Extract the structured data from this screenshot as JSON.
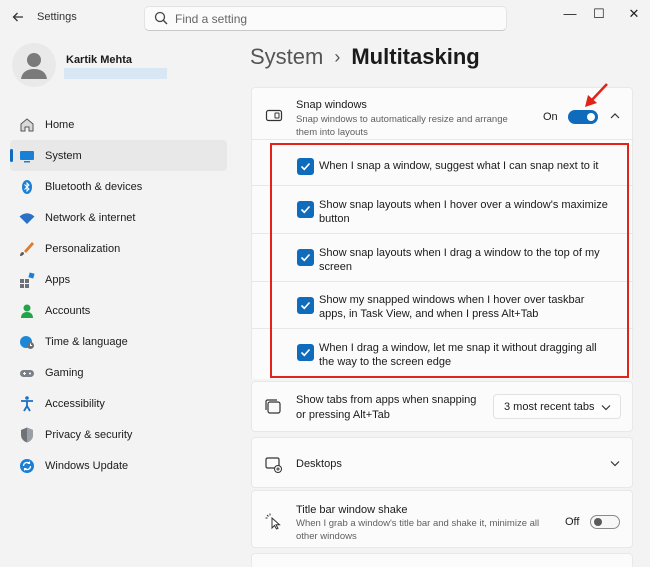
{
  "titlebar": {
    "app_title": "Settings",
    "search_placeholder": "Find a setting",
    "minimize": "—",
    "maximize": "☐",
    "close": "✕"
  },
  "user": {
    "name": "Kartik Mehta"
  },
  "sidebar": {
    "items": [
      {
        "label": "Home",
        "icon": "home-icon",
        "color": "#2d7fd3"
      },
      {
        "label": "System",
        "icon": "system-icon",
        "color": "#1a80d6"
      },
      {
        "label": "Bluetooth & devices",
        "icon": "bluetooth-icon",
        "color": "#1a80d6"
      },
      {
        "label": "Network & internet",
        "icon": "wifi-icon",
        "color": "#2b72c7"
      },
      {
        "label": "Personalization",
        "icon": "brush-icon",
        "color": "#e07a2d"
      },
      {
        "label": "Apps",
        "icon": "apps-icon",
        "color": "#6b6f78"
      },
      {
        "label": "Accounts",
        "icon": "accounts-icon",
        "color": "#23a34a"
      },
      {
        "label": "Time & language",
        "icon": "globe-clock-icon",
        "color": "#1e88d8"
      },
      {
        "label": "Gaming",
        "icon": "gamepad-icon",
        "color": "#7a7f88"
      },
      {
        "label": "Accessibility",
        "icon": "accessibility-icon",
        "color": "#1a6fc4"
      },
      {
        "label": "Privacy & security",
        "icon": "shield-icon",
        "color": "#6e7378"
      },
      {
        "label": "Windows Update",
        "icon": "update-icon",
        "color": "#1a80d6"
      }
    ],
    "active_index": 1
  },
  "breadcrumb": {
    "parent": "System",
    "separator": "›",
    "current": "Multitasking"
  },
  "snap": {
    "title": "Snap windows",
    "description": "Snap windows to automatically resize and arrange them into layouts",
    "toggle_label": "On",
    "toggle_state": "on",
    "options": [
      {
        "text": "When I snap a window, suggest what I can snap next to it",
        "checked": true
      },
      {
        "text": "Show snap layouts when I hover over a window's maximize button",
        "checked": true
      },
      {
        "text": "Show snap layouts when I drag a window to the top of my screen",
        "checked": true
      },
      {
        "text": "Show my snapped windows when I hover over taskbar apps, in Task View, and when I press Alt+Tab",
        "checked": true
      },
      {
        "text": "When I drag a window, let me snap it without dragging all the way to the screen edge",
        "checked": true
      }
    ]
  },
  "tabs": {
    "title": "Show tabs from apps when snapping or pressing Alt+Tab",
    "selected": "3 most recent tabs"
  },
  "desktops": {
    "title": "Desktops"
  },
  "shake": {
    "title": "Title bar window shake",
    "description": "When I grab a window's title bar and shake it, minimize all other windows",
    "toggle_label": "Off",
    "toggle_state": "off"
  },
  "colors": {
    "accent": "#0f6cbd",
    "highlight": "#e2231a"
  }
}
